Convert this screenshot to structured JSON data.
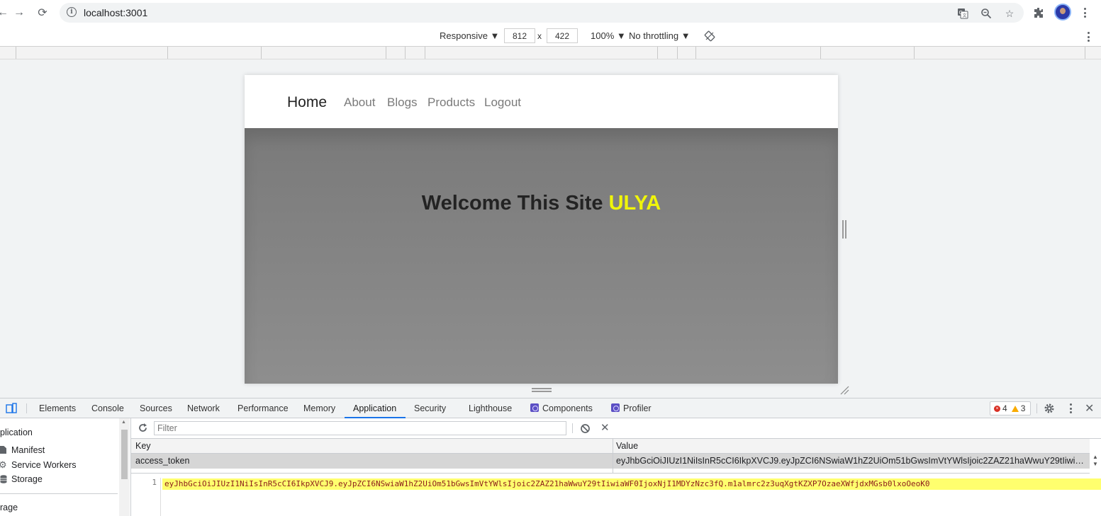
{
  "browser": {
    "url": "localhost:3001"
  },
  "device_toolbar": {
    "device": "Responsive ▼",
    "width": "812",
    "times": "x",
    "height": "422",
    "zoom": "100% ▼",
    "throttling": "No throttling ▼"
  },
  "site": {
    "brand": "Home",
    "nav_links": [
      "About",
      "Blogs",
      "Products",
      "Logout"
    ],
    "hero_title": "Welcome This Site",
    "hero_highlight": "ULYA",
    "highlight_color": "#f0f50a"
  },
  "devtools": {
    "tabs": [
      "Elements",
      "Console",
      "Sources",
      "Network",
      "Performance",
      "Memory",
      "Application",
      "Security",
      "Lighthouse",
      "Components",
      "Profiler"
    ],
    "active_tab": "Application",
    "error_count": "4",
    "warning_count": "3",
    "sidebar": {
      "section_title": "plication",
      "items": [
        "Manifest",
        "Service Workers",
        "Storage"
      ],
      "section2_title": "rage"
    },
    "filter_placeholder": "Filter",
    "table": {
      "headers": [
        "Key",
        "Value"
      ],
      "rows": [
        {
          "key": "access_token",
          "value": "eyJhbGciOiJIUzI1NiIsInR5cCI6IkpXVCJ9.eyJpZCI6NSwiaW1hZ2UiOm51bGwsImVtYWlsIjoic2ZAZ21haWwuY29tIiwiaWF0Ijo..."
        }
      ]
    },
    "preview": {
      "line_number": "1",
      "code": "eyJhbGciOiJIUzI1NiIsInR5cCI6IkpXVCJ9.eyJpZCI6NSwiaW1hZ2UiOm51bGwsImVtYWlsIjoic2ZAZ21haWwuY29tIiwiaWF0IjoxNjI1MDYzNzc3fQ.m1almrc2z3uqXgtKZXP7OzaeXWfjdxMGsb0lxoOeoK0"
    }
  }
}
